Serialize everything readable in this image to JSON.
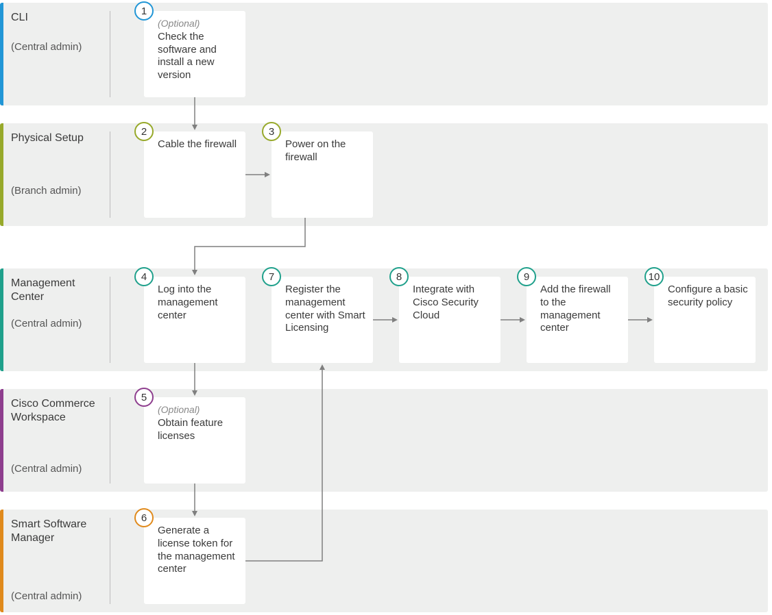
{
  "optional_label": "(Optional)",
  "lanes": {
    "cli": {
      "title": "CLI",
      "sub": "(Central admin)"
    },
    "phys": {
      "title": "Physical Setup",
      "sub": "(Branch admin)"
    },
    "mgmt": {
      "title": "Management Center",
      "sub": "(Central admin)"
    },
    "ccw": {
      "title": "Cisco Commerce Workspace",
      "sub": "(Central admin)"
    },
    "ssm": {
      "title": "Smart Software Manager",
      "sub": "(Central admin)"
    }
  },
  "steps": {
    "s1": {
      "num": "1",
      "text": "Check the software and install a new version"
    },
    "s2": {
      "num": "2",
      "text": "Cable the firewall"
    },
    "s3": {
      "num": "3",
      "text": "Power on the firewall"
    },
    "s4": {
      "num": "4",
      "text": "Log into the management center"
    },
    "s5": {
      "num": "5",
      "text": "Obtain feature licenses"
    },
    "s6": {
      "num": "6",
      "text": "Generate a license token for the management center"
    },
    "s7": {
      "num": "7",
      "text": "Register the management center with Smart Licensing"
    },
    "s8": {
      "num": "8",
      "text": "Integrate with Cisco Security Cloud"
    },
    "s9": {
      "num": "9",
      "text": "Add the firewall to the management center"
    },
    "s10": {
      "num": "10",
      "text": "Configure a basic security policy"
    }
  },
  "colors": {
    "cli": "#2196d6",
    "phys": "#97a92a",
    "mgmt": "#1fa08b",
    "ccw": "#8e3e8e",
    "ssm": "#e08a1c"
  }
}
